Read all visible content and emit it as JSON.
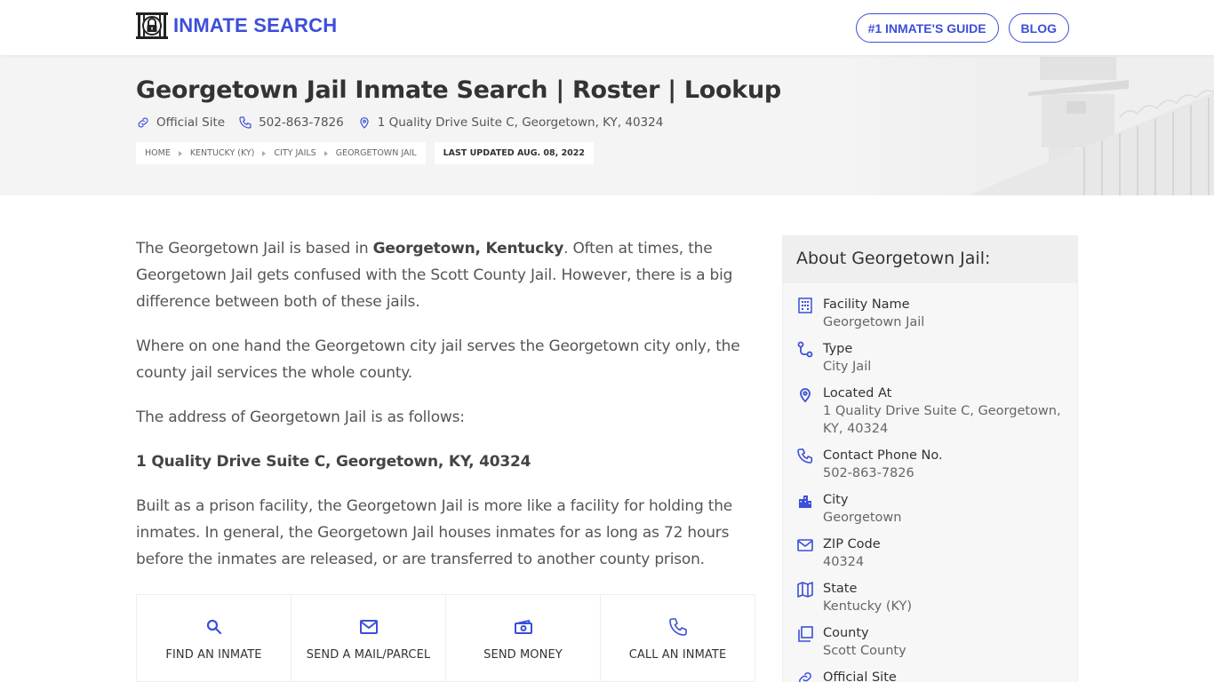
{
  "header": {
    "logo_text": "INMATE SEARCH",
    "nav": [
      {
        "label": "#1 INMATE'S GUIDE"
      },
      {
        "label": "BLOG"
      }
    ]
  },
  "hero": {
    "title": "Georgetown Jail Inmate Search | Roster | Lookup",
    "meta": {
      "official_site": "Official Site",
      "phone": "502-863-7826",
      "address": "1 Quality Drive Suite C, Georgetown, KY, 40324"
    },
    "breadcrumb": [
      "HOME",
      "KENTUCKY (KY)",
      "CITY JAILS",
      "GEORGETOWN JAIL"
    ],
    "last_updated": "LAST UPDATED AUG. 08, 2022"
  },
  "content": {
    "p1_start": "The Georgetown Jail is based in ",
    "p1_bold": "Georgetown, Kentucky",
    "p1_end": ". Often at times, the Georgetown Jail gets confused with the Scott County Jail. However, there is a big difference between both of these jails.",
    "p2": "Where on one hand the Georgetown city jail serves the Georgetown city only, the county jail services the whole county.",
    "p3": "The address of Georgetown Jail is as follows:",
    "p4_bold": "1 Quality Drive Suite C, Georgetown, KY, 40324",
    "p5": "Built as a prison facility, the Georgetown Jail is more like a facility for holding the inmates. In general, the Georgetown Jail houses inmates for as long as 72 hours before the inmates are released, or are transferred to another county prison."
  },
  "actions": [
    {
      "label": "FIND AN INMATE",
      "icon": "search-icon"
    },
    {
      "label": "SEND A MAIL/PARCEL",
      "icon": "mail-icon"
    },
    {
      "label": "SEND MONEY",
      "icon": "money-icon"
    },
    {
      "label": "CALL AN INMATE",
      "icon": "phone-icon"
    }
  ],
  "sidebar": {
    "title": "About Georgetown Jail:",
    "facts": [
      {
        "label": "Facility Name",
        "value": "Georgetown Jail",
        "icon": "building-icon"
      },
      {
        "label": "Type",
        "value": "City Jail",
        "icon": "route-icon"
      },
      {
        "label": "Located At",
        "value": "1 Quality Drive Suite C, Georgetown, KY, 40324",
        "icon": "location-pin-icon"
      },
      {
        "label": "Contact Phone No.",
        "value": "502-863-7826",
        "icon": "phone-icon"
      },
      {
        "label": "City",
        "value": "Georgetown",
        "icon": "city-icon"
      },
      {
        "label": "ZIP Code",
        "value": "40324",
        "icon": "mail-icon"
      },
      {
        "label": "State",
        "value": "Kentucky (KY)",
        "icon": "map-icon"
      },
      {
        "label": "County",
        "value": "Scott County",
        "icon": "county-icon"
      },
      {
        "label": "Official Site",
        "value": "",
        "icon": "link-icon"
      }
    ]
  },
  "colors": {
    "accent": "#3b4fd8",
    "hero_bg": "#f4f4f4",
    "sidebar_bg": "#f7f7f7"
  }
}
